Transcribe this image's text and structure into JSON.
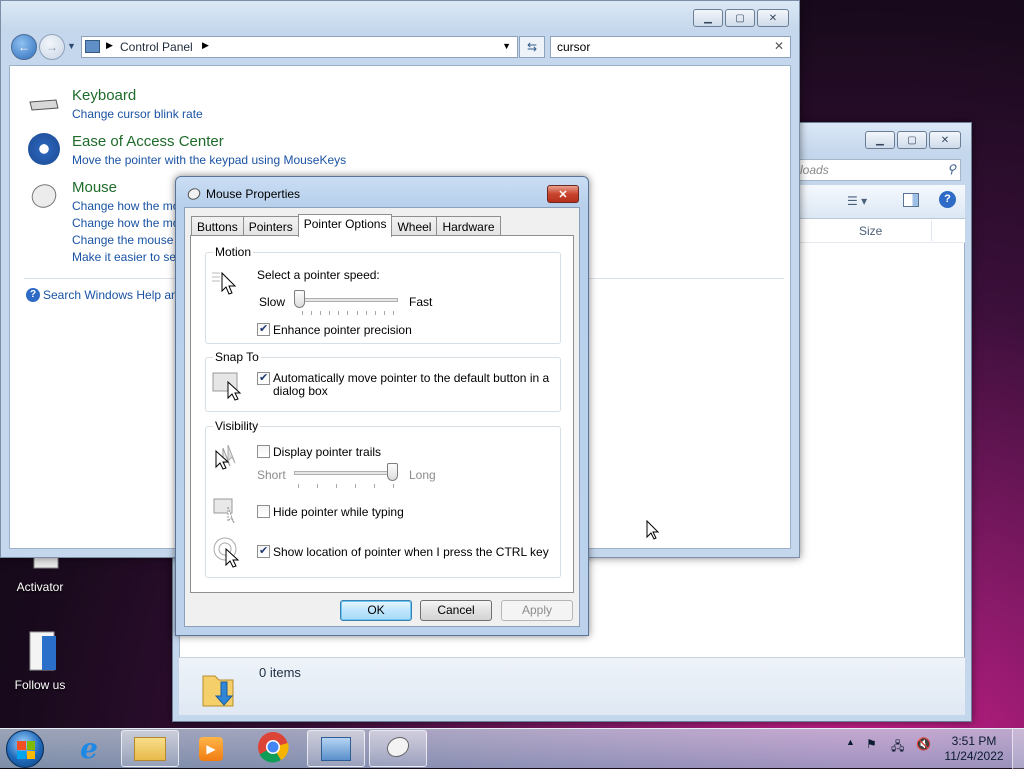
{
  "desktop": {
    "icons": [
      {
        "label": "Activator"
      },
      {
        "label": "Follow us"
      }
    ]
  },
  "downloads_window": {
    "search_placeholder": "Search Downloads",
    "search_visible_text": "loads",
    "column_size": "Size",
    "status_items": "0 items"
  },
  "control_panel": {
    "breadcrumb": "Control Panel",
    "search_value": "cursor",
    "sections": [
      {
        "title": "Keyboard",
        "links": [
          "Change cursor blink rate"
        ]
      },
      {
        "title": "Ease of Access Center",
        "links": [
          "Move the pointer with the keypad using MouseKeys"
        ]
      },
      {
        "title": "Mouse",
        "links": [
          "Change how the mo",
          "Change how the mo",
          "Change the mouse p",
          "Make it easier to see"
        ]
      }
    ],
    "help_link": "Search Windows Help and"
  },
  "dialog": {
    "title": "Mouse Properties",
    "tabs": [
      "Buttons",
      "Pointers",
      "Pointer Options",
      "Wheel",
      "Hardware"
    ],
    "active_tab": "Pointer Options",
    "motion": {
      "label": "Motion",
      "speed_label": "Select a pointer speed:",
      "slow": "Slow",
      "fast": "Fast",
      "speed_level": 0,
      "enhance_label": "Enhance pointer precision",
      "enhance_checked": true
    },
    "snap_to": {
      "label": "Snap To",
      "auto_label_line1": "Automatically move pointer to the default button in a",
      "auto_label_line2": "dialog box",
      "checked": true
    },
    "visibility": {
      "label": "Visibility",
      "trails_label": "Display pointer trails",
      "trails_checked": false,
      "short": "Short",
      "long": "Long",
      "trails_level": 1,
      "hide_label": "Hide pointer while typing",
      "hide_checked": false,
      "ctrl_label": "Show location of pointer when I press the CTRL key",
      "ctrl_checked": true
    },
    "buttons": {
      "ok": "OK",
      "cancel": "Cancel",
      "apply": "Apply"
    }
  },
  "taskbar": {
    "time": "3:51 PM",
    "date": "11/24/2022",
    "colors": {
      "ie": "#1e88e5",
      "chrome_red": "#db4437",
      "chrome_yellow": "#f4b400",
      "chrome_green": "#0f9d58",
      "chrome_blue": "#4285f4"
    }
  }
}
